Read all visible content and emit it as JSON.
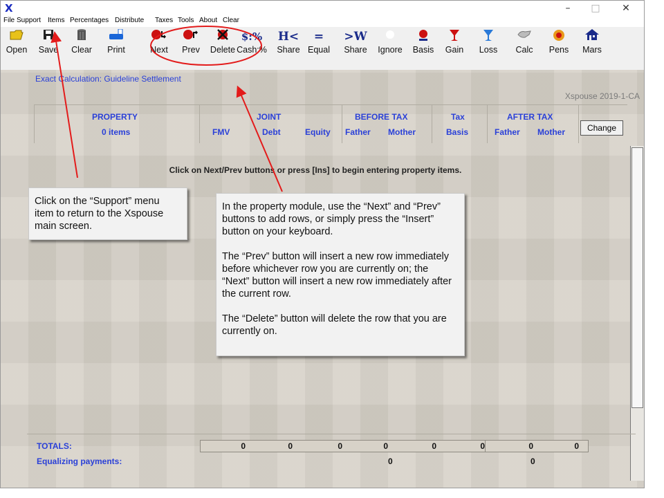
{
  "window": {
    "app_icon": "X",
    "controls": {
      "minimize": "–",
      "maximize": "□",
      "close": "✕"
    }
  },
  "menu": [
    "File",
    "Support",
    "Items",
    "Percentages",
    "Distribute",
    "Taxes",
    "Tools",
    "About",
    "Clear"
  ],
  "toolbar": [
    {
      "label": "Open",
      "icon": "folder-icon",
      "color": "#e8c21a"
    },
    {
      "label": "Save",
      "icon": "floppy-icon",
      "color": "#222222"
    },
    {
      "label": "Clear",
      "icon": "trash-icon",
      "color": "#555555"
    },
    {
      "label": "Print",
      "icon": "printer-icon",
      "color": "#1a66d8"
    },
    {
      "label": "Next",
      "icon": "next-row-icon",
      "color": "#cc1111"
    },
    {
      "label": "Prev",
      "icon": "prev-row-icon",
      "color": "#cc1111"
    },
    {
      "label": "Delete",
      "icon": "delete-row-icon",
      "color": "#cc1111"
    },
    {
      "label": "Cash:%",
      "icon_text": "$:%",
      "color": "#1a2b8a"
    },
    {
      "label": "Share",
      "icon_text": "H<",
      "color": "#1a2b8a"
    },
    {
      "label": "Equal",
      "icon_text": "=",
      "color": "#1a2b8a"
    },
    {
      "label": "Share",
      "icon_text": ">W",
      "color": "#1a2b8a"
    },
    {
      "label": "Ignore",
      "icon": "ignore-icon",
      "color": "#ffffff"
    },
    {
      "label": "Basis",
      "icon": "basis-icon",
      "color": "#cc1111"
    },
    {
      "label": "Gain",
      "icon": "gain-glass-icon",
      "color": "#cc1111"
    },
    {
      "label": "Loss",
      "icon": "loss-glass-icon",
      "color": "#2a7ad8"
    },
    {
      "label": "Calc",
      "icon": "calc-hand-icon",
      "color": "#888888"
    },
    {
      "label": "Pens",
      "icon": "pens-icon",
      "color": "#e89a1a"
    },
    {
      "label": "Mars",
      "icon": "house-icon",
      "color": "#1a2b8a"
    }
  ],
  "module": {
    "subtitle": "Exact Calculation: Guideline Settlement",
    "version": "Xspouse 2019-1-CA"
  },
  "headers": {
    "property": "PROPERTY",
    "items": "0 items",
    "joint": "JOINT",
    "fmv": "FMV",
    "debt": "Debt",
    "equity": "Equity",
    "before_tax": "BEFORE TAX",
    "before_father": "Father",
    "before_mother": "Mother",
    "tax": "Tax",
    "basis": "Basis",
    "after_tax": "AFTER TAX",
    "after_father": "Father",
    "after_mother": "Mother",
    "change_button": "Change"
  },
  "instruction": "Click on Next/Prev buttons or press [Ins] to begin entering property items.",
  "callouts": {
    "support": "Click on the “Support” menu item to return to the Xspouse main screen.",
    "property_p1": "In the property module, use the “Next” and “Prev” buttons to add rows, or simply press the “Insert” button on your keyboard.",
    "property_p2": "The “Prev” button will insert a new row immediately before whichever row you are currently on; the “Next” button will insert a new row immediately after the current row.",
    "property_p3": "The “Delete” button will delete the row that you are currently on."
  },
  "totals": {
    "label": "TOTALS:",
    "equalizing_label": "Equalizing payments:",
    "fmv": "0",
    "debt": "0",
    "equity": "0",
    "before_father": "0",
    "before_mother": "0",
    "basis": "0",
    "after_father": "0",
    "after_mother": "0",
    "equalizing_before": "0",
    "equalizing_after": "0"
  },
  "annotation_color": "#e31b1b"
}
